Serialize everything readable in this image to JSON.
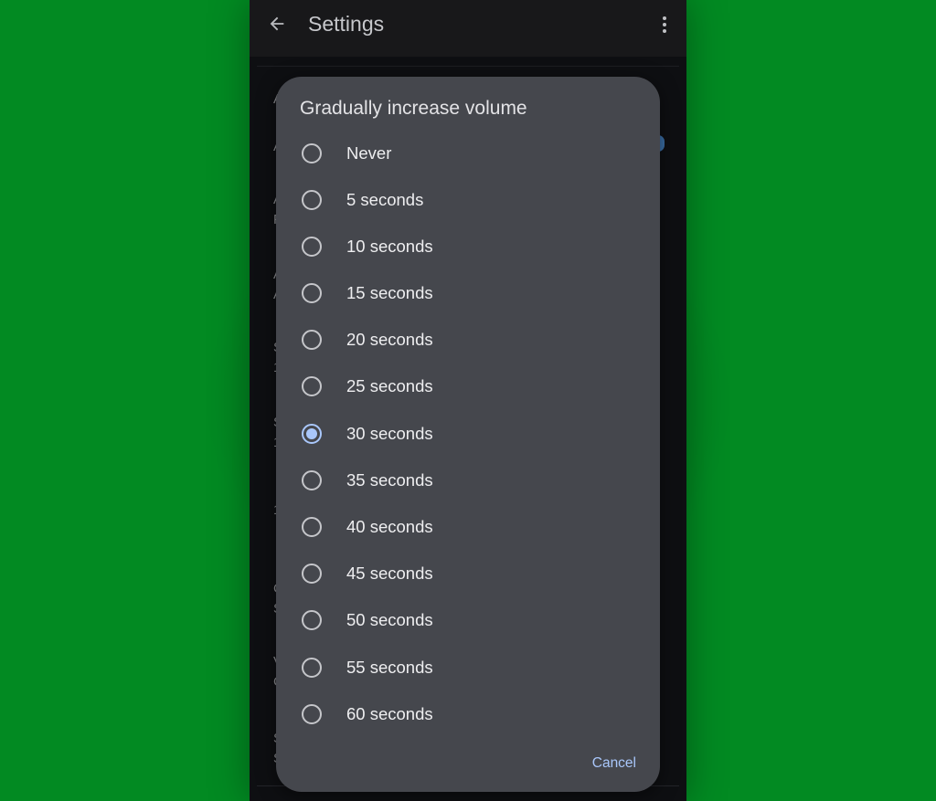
{
  "app_bar": {
    "title": "Settings",
    "back_icon": "arrow-left-icon",
    "more_icon": "more-vert-icon"
  },
  "background_list": {
    "obscured_rows": [
      "A",
      "A",
      "A",
      "F",
      "A",
      "A",
      "S",
      "1",
      "S",
      "1",
      "1",
      "C",
      "S",
      "V",
      "C",
      "S",
      "S"
    ]
  },
  "dialog": {
    "title": "Gradually increase volume",
    "options": [
      {
        "label": "Never",
        "selected": false
      },
      {
        "label": "5 seconds",
        "selected": false
      },
      {
        "label": "10 seconds",
        "selected": false
      },
      {
        "label": "15 seconds",
        "selected": false
      },
      {
        "label": "20 seconds",
        "selected": false
      },
      {
        "label": "25 seconds",
        "selected": false
      },
      {
        "label": "30 seconds",
        "selected": true
      },
      {
        "label": "35 seconds",
        "selected": false
      },
      {
        "label": "40 seconds",
        "selected": false
      },
      {
        "label": "45 seconds",
        "selected": false
      },
      {
        "label": "50 seconds",
        "selected": false
      },
      {
        "label": "55 seconds",
        "selected": false
      },
      {
        "label": "60 seconds",
        "selected": false
      }
    ],
    "selected_value": "30 seconds",
    "cancel_label": "Cancel"
  },
  "colors": {
    "background": "#028a22",
    "dialog_surface": "#45474d",
    "accent": "#a9c7fb",
    "app_bar": "#18181a"
  }
}
